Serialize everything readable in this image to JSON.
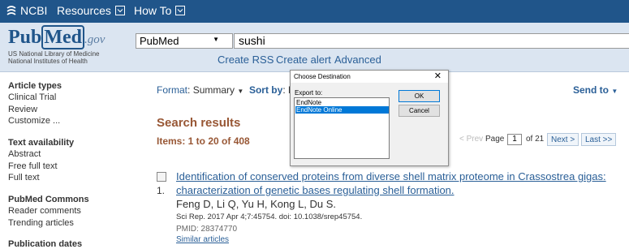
{
  "ncbi_bar": {
    "ncbi_label": "NCBI",
    "resources_label": "Resources",
    "howto_label": "How To"
  },
  "logo": {
    "pub": "Pub",
    "med": "Med",
    "gov": ".gov",
    "sub1": "US National Library of Medicine",
    "sub2": "National Institutes of Health"
  },
  "search": {
    "database": "PubMed",
    "query": "sushi",
    "links": [
      "Create RSS",
      "Create alert",
      "Advanced"
    ]
  },
  "sidebar": {
    "article_types": {
      "heading": "Article types",
      "items": [
        "Clinical Trial",
        "Review",
        "Customize ..."
      ]
    },
    "text_availability": {
      "heading": "Text availability",
      "items": [
        "Abstract",
        "Free full text",
        "Full text"
      ]
    },
    "pubmed_commons": {
      "heading": "PubMed Commons",
      "items": [
        "Reader comments",
        "Trending articles"
      ]
    },
    "publication_dates": {
      "heading": "Publication dates"
    }
  },
  "toolbar": {
    "format_label": "Format",
    "format_value": "Summary",
    "sort_label": "Sort by",
    "sort_value_partial": "M",
    "send_to": "Send to"
  },
  "results": {
    "heading": "Search results",
    "items_label": "Items: 1 to 20 of 408",
    "pager": {
      "prev": "< Prev",
      "page_label": "Page",
      "page_value": "1",
      "of_label": "of 21",
      "next": "Next >",
      "last": "Last >>"
    },
    "list": [
      {
        "number": "1.",
        "title_line1": "Identification of conserved proteins from diverse shell matrix proteome in Crassostrea gigas:",
        "title_line2": "characterization of genetic bases regulating shell formation.",
        "authors": "Feng D, Li Q, Yu H, Kong L, Du S.",
        "journal": "Sci Rep. 2017 Apr 4;7:45754. doi: 10.1038/srep45754.",
        "pmid": "PMID: 28374770",
        "similar": "Similar articles"
      }
    ]
  },
  "dialog": {
    "title": "Choose Destination",
    "close": "✕",
    "export_label": "Export to:",
    "options": [
      "EndNote",
      "EndNote Online"
    ],
    "selected_option": "EndNote Online",
    "ok": "OK",
    "cancel": "Cancel"
  },
  "colors": {
    "ncbi_bar": "#20558a",
    "header_bg": "#dbe5f1",
    "link": "#2a5f97",
    "heading_brown": "#985735",
    "selection": "#0078d7"
  }
}
